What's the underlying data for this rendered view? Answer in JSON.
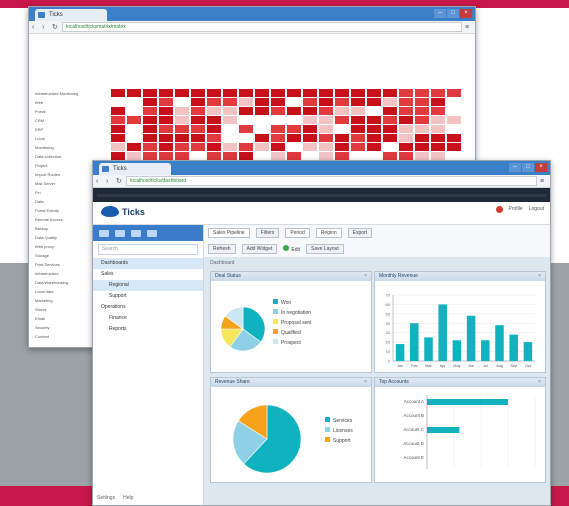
{
  "colors": {
    "brand_red": "#c8184a",
    "gray_band": "#9da2a7",
    "teal": "#11b2c0",
    "light_blue": "#8ed1e6",
    "yellow": "#f6e65c",
    "orange": "#f7a21b",
    "heat_dark": "#c8101a",
    "heat_mid": "#e0393e",
    "heat_light": "#f3c3c3"
  },
  "back_window": {
    "tab_title": "Ticks",
    "url": "localhost/ticksmatrix/matrix",
    "row_labels": [
      "Infrastructure Monitoring",
      "Web",
      "Portal",
      "CRM",
      "ERP",
      "Local",
      "Monitoring",
      "Data collection",
      "Project",
      "Import Routes",
      "Mail Server",
      "Fin",
      "Data",
      "Portal Events",
      "Remote Access",
      "Backup",
      "Data Quality",
      "Web proxy",
      "Storage",
      "Print Services",
      "Infrastructure",
      "Data Warehousing",
      "Local data",
      "Marketing",
      "Stores",
      "Email",
      "Security",
      "Content"
    ],
    "col_count": 22
  },
  "front_window": {
    "tab_title": "Ticks",
    "url": "localhost/ticks/dashboard",
    "logo_text": "Ticks",
    "user_links": [
      "Profile",
      "Logout"
    ],
    "sidebar": {
      "search_placeholder": "Search",
      "items": [
        "Dashboards",
        "Sales",
        "Regional",
        "Support",
        "Operations",
        "Finance",
        "Reports"
      ],
      "footer": [
        "Settings",
        "Help"
      ]
    },
    "toolbar": {
      "row1": [
        "Sales Pipeline",
        "Filters",
        "Period",
        "Region",
        "Export"
      ],
      "row2": [
        "Refresh",
        "Add Widget",
        "Edit",
        "Save Layout"
      ]
    },
    "dashboard_title": "Dashboard",
    "panels": {
      "pie1": {
        "title": "Deal Status",
        "slices": [
          {
            "label": "Won",
            "value": 35
          },
          {
            "label": "In negotiation",
            "value": 25
          },
          {
            "label": "Proposal sent",
            "value": 15
          },
          {
            "label": "Qualified",
            "value": 10
          },
          {
            "label": "Prospect",
            "value": 15
          }
        ]
      },
      "bar1": {
        "title": "Monthly Revenue",
        "categories": [
          "Jan",
          "Feb",
          "Mar",
          "Apr",
          "May",
          "Jun",
          "Jul",
          "Aug",
          "Sep",
          "Oct"
        ],
        "values": [
          18,
          40,
          25,
          60,
          22,
          48,
          22,
          38,
          28,
          20
        ],
        "ylim": [
          0,
          70
        ]
      },
      "pie2": {
        "title": "Revenue Share",
        "slices": [
          {
            "label": "Services",
            "value": 62
          },
          {
            "label": "Licenses",
            "value": 22
          },
          {
            "label": "Support",
            "value": 16
          }
        ]
      },
      "hbar": {
        "title": "Top Accounts",
        "categories": [
          "Account A",
          "Account B",
          "Account C",
          "Account D",
          "Account E"
        ],
        "values": [
          75,
          0,
          30,
          0,
          0
        ]
      }
    }
  }
}
